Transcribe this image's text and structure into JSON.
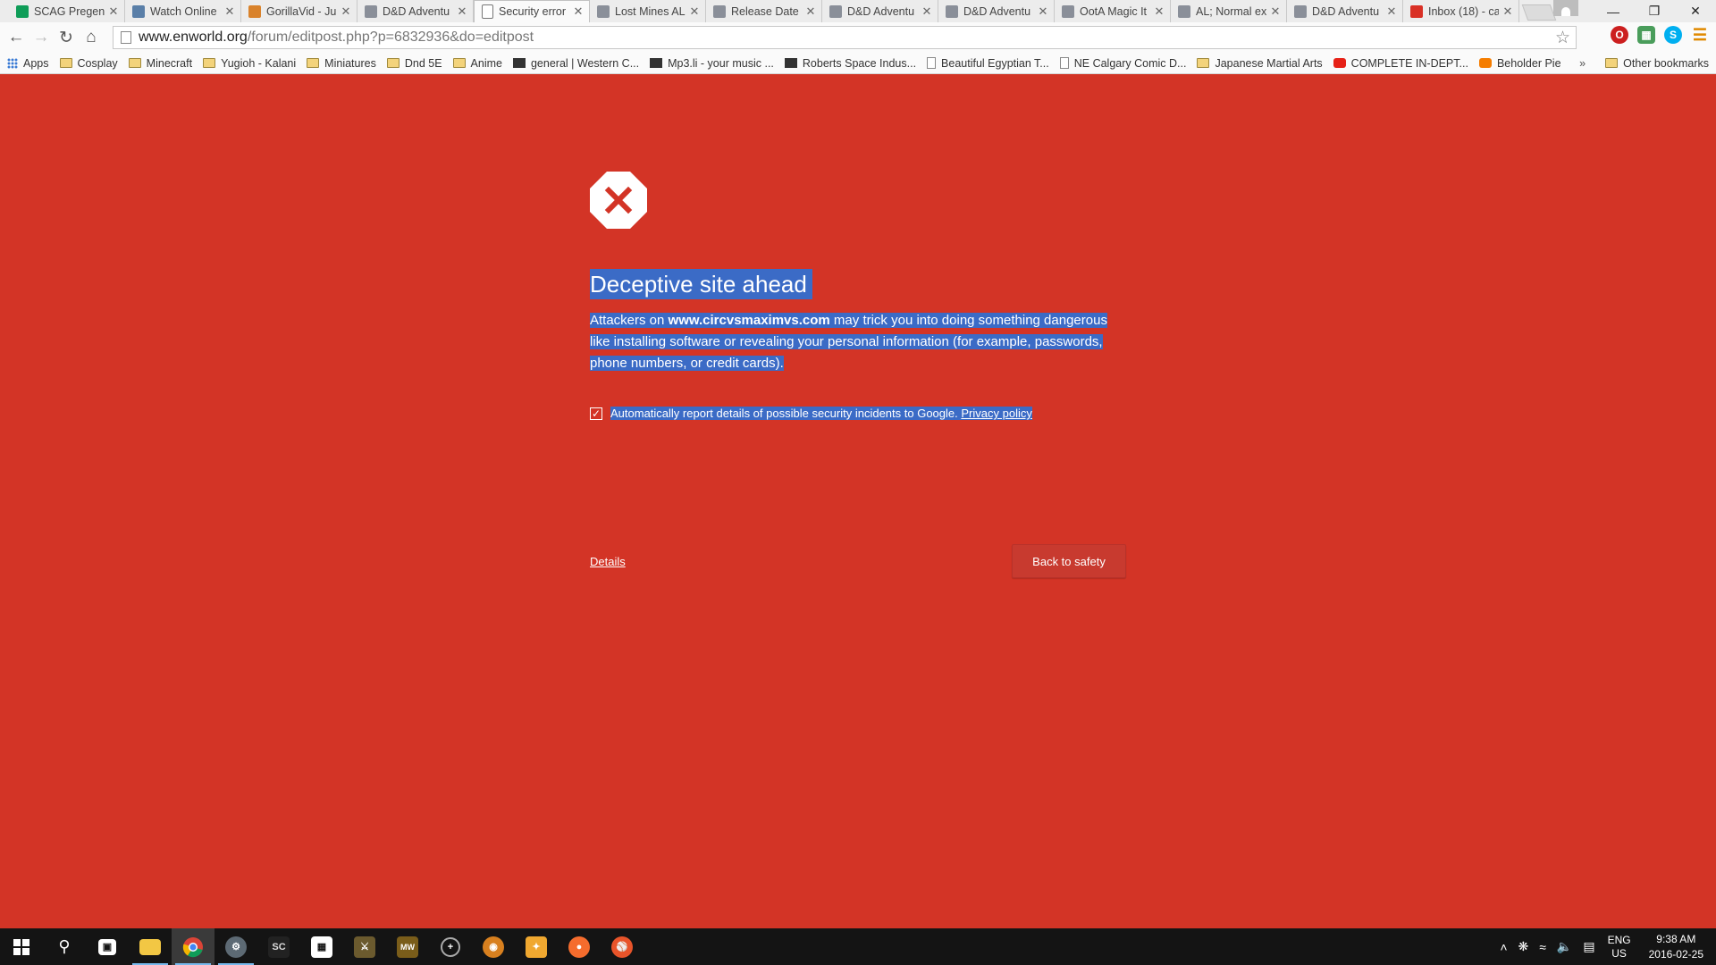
{
  "tabs": [
    {
      "title": "SCAG Pregen",
      "favicon": "sheets-icon",
      "color": "#0f9d58"
    },
    {
      "title": "Watch Online",
      "favicon": "bird-icon",
      "color": "#5a7fa8"
    },
    {
      "title": "GorillaVid - Ju",
      "favicon": "gorilla-icon",
      "color": "#d9822b"
    },
    {
      "title": "D&D Adventu",
      "favicon": "dnd-icon",
      "color": "#8a8f99"
    },
    {
      "title": "Security error",
      "favicon": "page-icon",
      "color": "#ffffff",
      "active": true
    },
    {
      "title": "Lost Mines AL",
      "favicon": "dnd-icon",
      "color": "#8a8f99"
    },
    {
      "title": "Release Date",
      "favicon": "dnd-icon",
      "color": "#8a8f99"
    },
    {
      "title": "D&D Adventu",
      "favicon": "dnd-icon",
      "color": "#8a8f99"
    },
    {
      "title": "D&D Adventu",
      "favicon": "dnd-icon",
      "color": "#8a8f99"
    },
    {
      "title": "OotA Magic It",
      "favicon": "dnd-icon",
      "color": "#8a8f99"
    },
    {
      "title": "AL; Normal ex",
      "favicon": "dnd-icon",
      "color": "#8a8f99"
    },
    {
      "title": "D&D Adventu",
      "favicon": "dnd-icon",
      "color": "#8a8f99"
    },
    {
      "title": "Inbox (18) - ca",
      "favicon": "gmail-icon",
      "color": "#d93025"
    }
  ],
  "address": {
    "host": "www.enworld.org",
    "path": "/forum/editpost.php?p=6832936&do=editpost"
  },
  "bookmarks": [
    {
      "label": "Apps",
      "icon": "apps"
    },
    {
      "label": "Cosplay",
      "icon": "folder"
    },
    {
      "label": "Minecraft",
      "icon": "folder"
    },
    {
      "label": "Yugioh - Kalani",
      "icon": "folder"
    },
    {
      "label": "Miniatures",
      "icon": "folder"
    },
    {
      "label": "Dnd 5E",
      "icon": "folder"
    },
    {
      "label": "Anime",
      "icon": "folder"
    },
    {
      "label": "general | Western C...",
      "icon": "dark"
    },
    {
      "label": "Mp3.li - your music ...",
      "icon": "dark"
    },
    {
      "label": "Roberts Space Indus...",
      "icon": "dark"
    },
    {
      "label": "Beautiful Egyptian T...",
      "icon": "page"
    },
    {
      "label": "NE Calgary Comic D...",
      "icon": "page"
    },
    {
      "label": "Japanese Martial Arts",
      "icon": "folder"
    },
    {
      "label": "COMPLETE IN-DEPT...",
      "icon": "red"
    },
    {
      "label": "Beholder Pie",
      "icon": "orange"
    }
  ],
  "bookmarks_more": "»",
  "other_bookmarks": "Other bookmarks",
  "interstitial": {
    "headline": "Deceptive site ahead",
    "message_prefix": "Attackers on ",
    "site": "www.circvsmaximvs.com",
    "message_suffix": " may trick you into doing something dangerous like installing software or revealing your personal information (for example, passwords, phone numbers, or credit cards).",
    "report_label": "Automatically report details of possible security incidents to Google.",
    "privacy_link": "Privacy policy",
    "report_checked": true,
    "details_link": "Details",
    "back_button": "Back to safety",
    "background_color": "#d33426",
    "highlight_color": "#3b6bc6"
  },
  "taskbar": {
    "apps": [
      {
        "name": "start-icon"
      },
      {
        "name": "search-icon"
      },
      {
        "name": "store-icon"
      },
      {
        "name": "file-explorer-icon"
      },
      {
        "name": "chrome-icon"
      },
      {
        "name": "steam-icon"
      },
      {
        "name": "sc-app-icon"
      },
      {
        "name": "calculator-icon"
      },
      {
        "name": "game-icon"
      },
      {
        "name": "mw-icon"
      },
      {
        "name": "crosshair-icon"
      },
      {
        "name": "overwatch-icon"
      },
      {
        "name": "puzzle-icon"
      },
      {
        "name": "origin-icon"
      },
      {
        "name": "basketball-icon"
      }
    ],
    "sc_label": "SC",
    "mw_label": "MW",
    "lang_top": "ENG",
    "lang_bottom": "US",
    "time": "9:38 AM",
    "date": "2016-02-25"
  }
}
